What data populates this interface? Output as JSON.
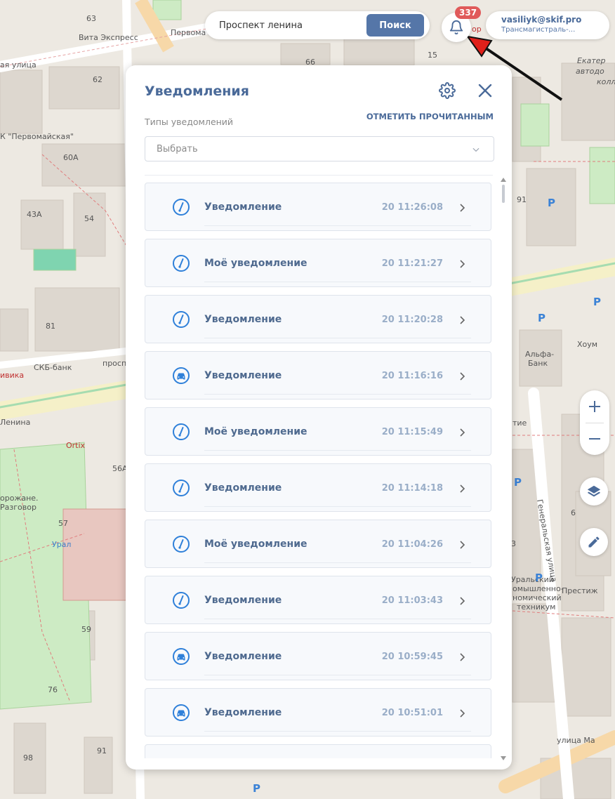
{
  "search": {
    "value": "Проспект ленина",
    "button": "Поиск"
  },
  "notifications_badge": "337",
  "user": {
    "email": "vasiliyk@skif.pro",
    "org": "Трансмагистраль-..."
  },
  "panel": {
    "title": "Уведомления",
    "mark_read": "ОТМЕТИТЬ ПРОЧИТАННЫМ",
    "types_label": "Типы уведомлений",
    "select_placeholder": "Выбрать",
    "items": [
      {
        "title": "Уведомление",
        "time": "20 11:26:08",
        "icon": "speedometer-icon"
      },
      {
        "title": "Моё уведомление",
        "time": "20 11:21:27",
        "icon": "speedometer-icon"
      },
      {
        "title": "Уведомление",
        "time": "20 11:20:28",
        "icon": "speedometer-icon"
      },
      {
        "title": "Уведомление",
        "time": "20 11:16:16",
        "icon": "car-icon"
      },
      {
        "title": "Моё уведомление",
        "time": "20 11:15:49",
        "icon": "speedometer-icon"
      },
      {
        "title": "Уведомление",
        "time": "20 11:14:18",
        "icon": "speedometer-icon"
      },
      {
        "title": "Моё уведомление",
        "time": "20 11:04:26",
        "icon": "speedometer-icon"
      },
      {
        "title": "Уведомление",
        "time": "20 11:03:43",
        "icon": "speedometer-icon"
      },
      {
        "title": "Уведомление",
        "time": "20 10:59:45",
        "icon": "car-icon"
      },
      {
        "title": "Уведомление",
        "time": "20 10:51:01",
        "icon": "car-icon"
      }
    ]
  },
  "map": {
    "labels": [
      "Вита Экспресс",
      "Первома",
      "ая улица",
      "К \"Первомайская\"",
      "СКБ-банк",
      "просп",
      "ивика",
      "Ленина",
      "Ortix",
      "орожане.",
      "Разговор",
      "Урал",
      "Альфа-",
      "Банк",
      "Хоум",
      "Генеральская улица",
      "Престиж",
      "Уральский",
      "омышленно-",
      "номический",
      "техникум",
      "улица Ма",
      "Екатер",
      "автодо",
      "колл",
      "ор",
      "тие"
    ],
    "numbers": [
      "63",
      "62",
      "66",
      "15",
      "60А",
      "43А",
      "54",
      "81",
      "56А",
      "57",
      "59",
      "76",
      "98",
      "91",
      "91",
      "6",
      "3"
    ],
    "parking": "P",
    "colors": {
      "panel_title": "#4a6a99",
      "button": "#5576a8",
      "badge": "#e05a5a",
      "icon": "#2f80d9"
    }
  }
}
